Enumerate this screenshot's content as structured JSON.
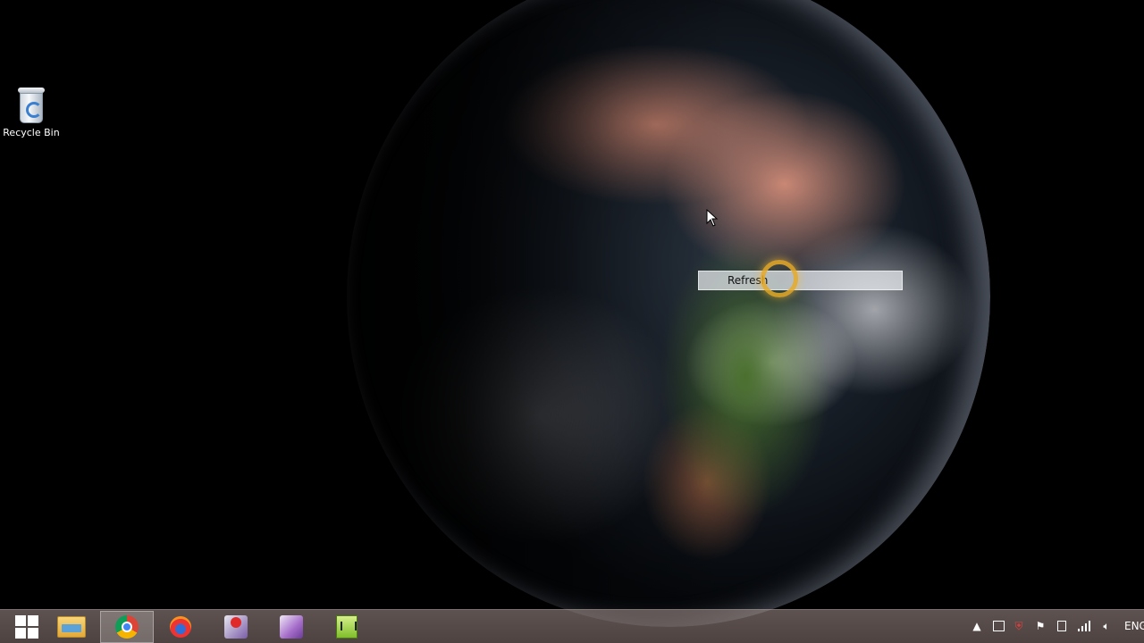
{
  "desktop": {
    "icons": [
      {
        "label": "Recycle Bin",
        "icon": "recycle-bin-icon"
      }
    ]
  },
  "context_menu": {
    "items": [
      {
        "label": "Refresh",
        "highlighted": true
      }
    ]
  },
  "taskbar": {
    "pinned": [
      {
        "name": "start",
        "icon": "windows-logo-icon"
      },
      {
        "name": "file-explorer",
        "icon": "folder-icon"
      },
      {
        "name": "chrome",
        "icon": "chrome-icon",
        "active": true
      },
      {
        "name": "browser",
        "icon": "flame-browser-icon"
      },
      {
        "name": "screen-recorder",
        "icon": "recorder-icon"
      },
      {
        "name": "video-editor",
        "icon": "editor-icon"
      },
      {
        "name": "audio-editor",
        "icon": "audio-editor-icon"
      }
    ],
    "tray": {
      "icons": [
        "chevron-up-icon",
        "windows-tray-icon",
        "shield-icon",
        "flag-icon",
        "device-icon",
        "signal-icon",
        "volume-icon"
      ],
      "language": "ENG"
    }
  },
  "colors": {
    "accent_ring": "#e6aa28",
    "taskbar": "#aa9691"
  }
}
